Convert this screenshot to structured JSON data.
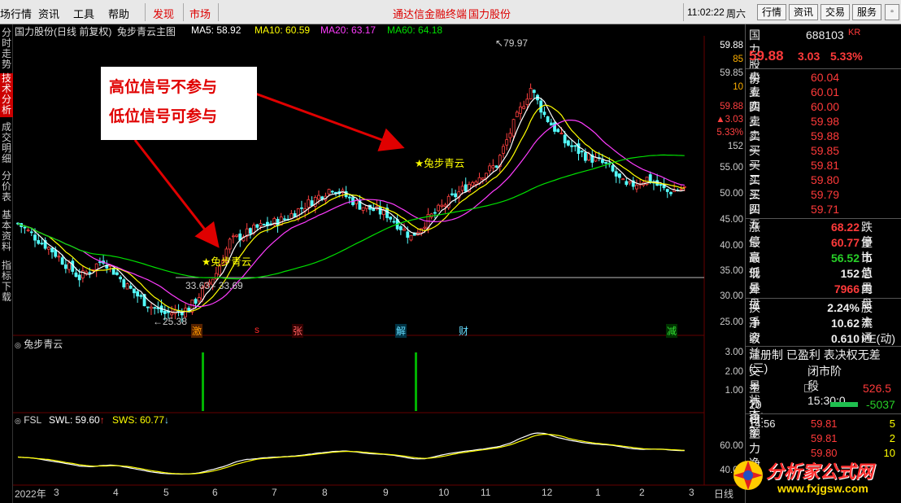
{
  "menubar": {
    "items": [
      "场行情",
      "资讯",
      "工具",
      "帮助",
      "发现",
      "市场"
    ],
    "center_text": "通达信金融终端",
    "center_stock": "国力股份",
    "time": "11:02:22",
    "weekday": "周六",
    "buttons": [
      "行情",
      "资讯",
      "交易",
      "服务"
    ]
  },
  "sidebar": {
    "tabs": [
      "分时走势",
      "技术分析",
      "成交明细",
      "分价表",
      "基本资料",
      "指标下载"
    ],
    "active": "技术分析"
  },
  "main_chart": {
    "title": "国力股份(日线 前复权)",
    "formula": "兔步青云主图",
    "ma": [
      {
        "label": "MA5: 58.92",
        "color": "#ffffff"
      },
      {
        "label": "MA10: 60.59",
        "color": "#ffff00"
      },
      {
        "label": "MA20: 63.17",
        "color": "#ff3cff"
      },
      {
        "label": "MA60: 64.18",
        "color": "#00e000"
      }
    ],
    "y_ticks": [
      "59.88",
      "85",
      "59.85",
      "10",
      "59.88",
      "▲3.03",
      "5.33%",
      "152",
      "55.00",
      "50.00",
      "45.00",
      "40.00",
      "35.00",
      "30.00",
      "25.00"
    ],
    "high_label": "79.97",
    "low_label": "25.38",
    "range_label": "33.63 - 33.69",
    "signal_label": "★兔步青云",
    "annotation_1": "高位信号不参与",
    "annotation_2": "低位信号可参与",
    "event_markers": [
      "激",
      "s",
      "张",
      "解",
      "财",
      "减"
    ]
  },
  "sub1": {
    "title": "兔步青云",
    "y_ticks": [
      "3.00",
      "2.00",
      "1.00"
    ]
  },
  "sub2": {
    "name": "FSL",
    "swl": "SWL: 59.60",
    "sws": "SWS: 60.77",
    "y_ticks": [
      "60.00",
      "40.00"
    ]
  },
  "x_axis": {
    "labels": [
      "2022年",
      "3",
      "4",
      "5",
      "6",
      "7",
      "8",
      "9",
      "10",
      "11",
      "12",
      "1",
      "2",
      "3"
    ],
    "right": "日线"
  },
  "quote": {
    "name": "国力股份",
    "code": "688103",
    "tag": "KR",
    "price": "59.88",
    "change": "3.03",
    "pct": "5.33%",
    "asks": [
      {
        "label": "卖五",
        "price": "60.04"
      },
      {
        "label": "卖四",
        "price": "60.01"
      },
      {
        "label": "卖三",
        "price": "60.00"
      },
      {
        "label": "卖二",
        "price": "59.98"
      },
      {
        "label": "卖一",
        "price": "59.88"
      }
    ],
    "bids": [
      {
        "label": "买一",
        "price": "59.85"
      },
      {
        "label": "买二",
        "price": "59.81"
      },
      {
        "label": "买三",
        "price": "59.80"
      },
      {
        "label": "买四",
        "price": "59.79"
      },
      {
        "label": "买五",
        "price": "59.71"
      }
    ],
    "stats": [
      {
        "l": "涨停",
        "v": "68.22",
        "r": "跌停",
        "c": "red"
      },
      {
        "l": "最高",
        "v": "60.77",
        "r": "量比",
        "c": "red"
      },
      {
        "l": "最低",
        "v": "56.52",
        "r": "市值",
        "c": "green"
      },
      {
        "l": "现量",
        "v": "152",
        "r": "总量",
        "c": "white"
      },
      {
        "l": "外盘",
        "v": "7966",
        "r": "内盘",
        "c": "red"
      }
    ],
    "stats2": [
      {
        "l": "换手",
        "v": "2.24%",
        "r": "股本"
      },
      {
        "l": "净资",
        "v": "10.62",
        "r": "流通"
      },
      {
        "l": "收益(三)",
        "v": "0.610",
        "r": "PE(动)"
      }
    ],
    "info1": "注册制 已盈利 表决权无差",
    "info2_label": "交易状态:",
    "info2_val": "闭市阶段 15:30:0",
    "main_net_label": "主力净额",
    "main_net_val": "526.5",
    "main_net10_label": "10日主力净额",
    "main_net10_val": "-5037",
    "ticks": [
      {
        "t": "14:56",
        "p": "59.81",
        "v": "5"
      },
      {
        "t": "",
        "p": "59.81",
        "v": "2"
      },
      {
        "t": "",
        "p": "59.80",
        "v": "10"
      }
    ]
  },
  "watermark": {
    "brand": "分析家公式网",
    "url": "www.fxjgsw.com"
  }
}
